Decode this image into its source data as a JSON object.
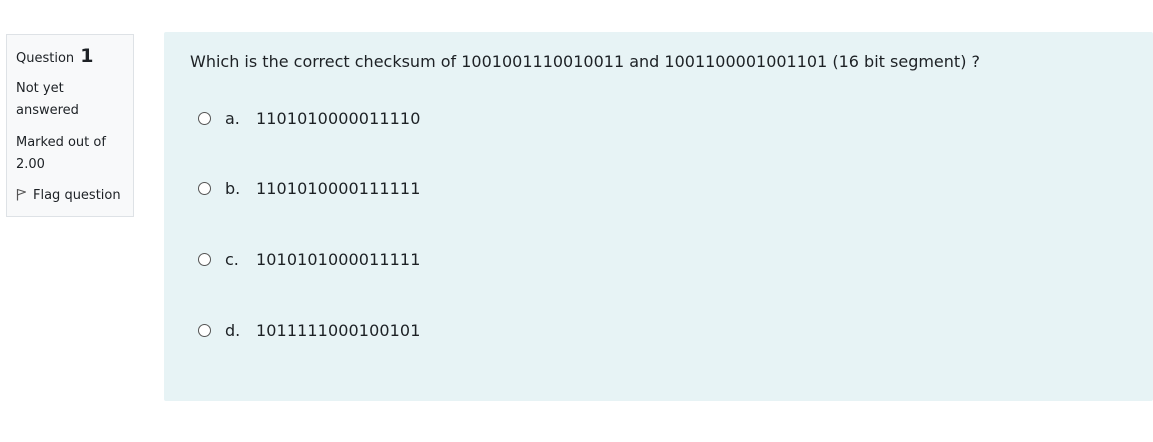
{
  "question_info": {
    "label": "Question",
    "number": "1",
    "state": "Not yet answered",
    "grade": "Marked out of 2.00",
    "flag_label": "Flag question"
  },
  "question": {
    "text": "Which is the correct checksum of 1001001110010011 and 1001100001001101 (16 bit segment) ?",
    "options": [
      {
        "letter": "a.",
        "text": "1101010000011110"
      },
      {
        "letter": "b.",
        "text": "1101010000111111"
      },
      {
        "letter": "c.",
        "text": "1010101000011111"
      },
      {
        "letter": "d.",
        "text": "1011111000100101"
      }
    ]
  },
  "colors": {
    "content_background": "#e7f3f5",
    "info_background": "#f8f9fa",
    "info_border": "#dee2e6"
  }
}
